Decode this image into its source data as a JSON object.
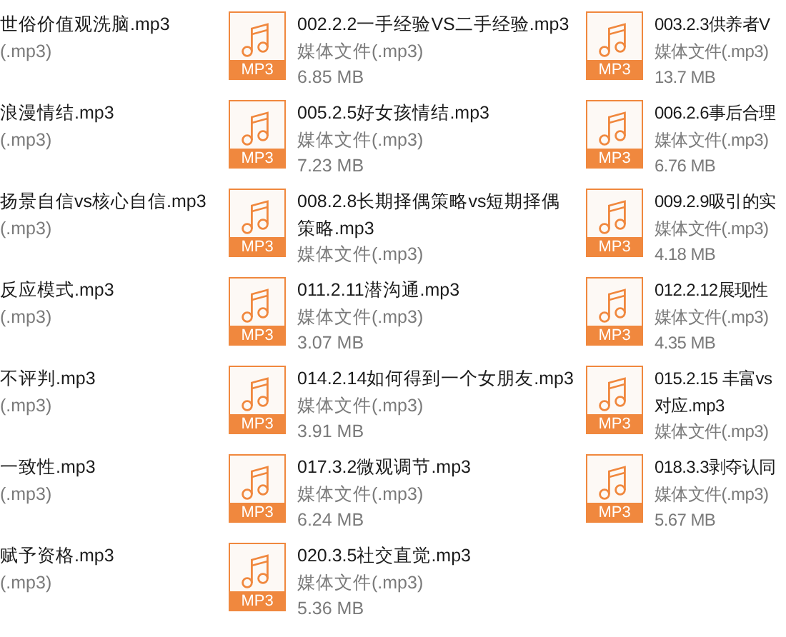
{
  "columns": [
    {
      "items": [
        {
          "name": "世俗价值观洗脑.mp3",
          "type": "(.mp3)"
        },
        {
          "name": "浪漫情结.mp3",
          "type": "(.mp3)"
        },
        {
          "name": "扬景自信vs核心自信.mp3",
          "type": "(.mp3)"
        },
        {
          "name": "反应模式.mp3",
          "type": "(.mp3)"
        },
        {
          "name": "不评判.mp3",
          "type": "(.mp3)"
        },
        {
          "name": "一致性.mp3",
          "type": "(.mp3)"
        },
        {
          "name": "赋予资格.mp3",
          "type": "(.mp3)"
        }
      ]
    },
    {
      "items": [
        {
          "icon_label": "MP3",
          "name": "002.2.2一手经验VS二手经验.mp3",
          "type": "媒体文件(.mp3)",
          "size": "6.85 MB"
        },
        {
          "icon_label": "MP3",
          "name": "005.2.5好女孩情结.mp3",
          "type": "媒体文件(.mp3)",
          "size": "7.23 MB"
        },
        {
          "icon_label": "MP3",
          "name": "008.2.8长期择偶策略vs短期择偶策略.mp3",
          "type": "媒体文件(.mp3)"
        },
        {
          "icon_label": "MP3",
          "name": "011.2.11潜沟通.mp3",
          "type": "媒体文件(.mp3)",
          "size": "3.07 MB"
        },
        {
          "icon_label": "MP3",
          "name": "014.2.14如何得到一个女朋友.mp3",
          "type": "媒体文件(.mp3)",
          "size": "3.91 MB"
        },
        {
          "icon_label": "MP3",
          "name": "017.3.2微观调节.mp3",
          "type": "媒体文件(.mp3)",
          "size": "6.24 MB"
        },
        {
          "icon_label": "MP3",
          "name": "020.3.5社交直觉.mp3",
          "type": "媒体文件(.mp3)",
          "size": "5.36 MB"
        }
      ]
    },
    {
      "items": [
        {
          "icon_label": "MP3",
          "name": "003.2.3供养者V",
          "type": "媒体文件(.mp3)",
          "size": "13.7 MB"
        },
        {
          "icon_label": "MP3",
          "name": "006.2.6事后合理",
          "type": "媒体文件(.mp3)",
          "size": "6.76 MB"
        },
        {
          "icon_label": "MP3",
          "name": "009.2.9吸引的实",
          "type": "媒体文件(.mp3)",
          "size": "4.18 MB"
        },
        {
          "icon_label": "MP3",
          "name": "012.2.12展现性",
          "type": "媒体文件(.mp3)",
          "size": "4.35 MB"
        },
        {
          "icon_label": "MP3",
          "name": "015.2.15 丰富vs",
          "name_line_2": "对应.mp3",
          "type": "媒体文件(.mp3)"
        },
        {
          "icon_label": "MP3",
          "name": "018.3.3剥夺认同",
          "type": "媒体文件(.mp3)",
          "size": "5.67 MB"
        }
      ]
    }
  ]
}
